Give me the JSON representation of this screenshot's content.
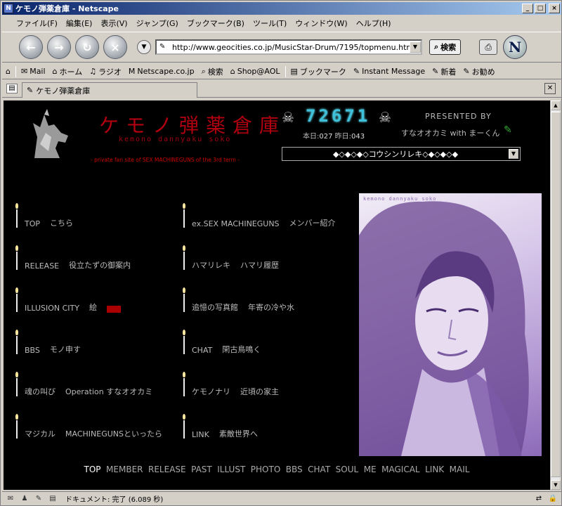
{
  "window": {
    "title": "ケモノ弾薬倉庫 - Netscape",
    "app_icon": "netscape-n-icon",
    "controls": {
      "minimize": "_",
      "maximize": "□",
      "close": "×"
    }
  },
  "menubar": {
    "items": [
      "ファイル(F)",
      "編集(E)",
      "表示(V)",
      "ジャンプ(G)",
      "ブックマーク(B)",
      "ツール(T)",
      "ウィンドウ(W)",
      "ヘルプ(H)"
    ]
  },
  "navbar": {
    "back_glyph": "←",
    "forward_glyph": "→",
    "reload_glyph": "↻",
    "stop_glyph": "×",
    "url": "http://www.geocities.co.jp/MusicStar-Drum/7195/topmenu.html",
    "search_label": "検索"
  },
  "personalbar": {
    "items": [
      {
        "label": "",
        "icon": "home-toolbar-icon",
        "glyph": "⌂"
      },
      {
        "label": "Mail",
        "icon": "mail-icon",
        "glyph": "✉"
      },
      {
        "label": "ホーム",
        "icon": "home-icon",
        "glyph": "⌂"
      },
      {
        "label": "ラジオ",
        "icon": "radio-icon",
        "glyph": "♫"
      },
      {
        "label": "Netscape.co.jp",
        "icon": "my-netscape-icon",
        "glyph": "M"
      },
      {
        "label": "検索",
        "icon": "search-icon",
        "glyph": "⌕"
      },
      {
        "label": "Shop@AOL",
        "icon": "shop-icon",
        "glyph": "⌂"
      },
      {
        "label": "ブックマーク",
        "icon": "bookmark-folder-icon",
        "glyph": "▤"
      },
      {
        "label": "Instant Message",
        "icon": "im-icon",
        "glyph": "✎"
      },
      {
        "label": "新着",
        "icon": "new-icon",
        "glyph": "✎"
      },
      {
        "label": "お勧め",
        "icon": "recommend-icon",
        "glyph": "✎"
      }
    ]
  },
  "tab": {
    "label": "ケモノ弾薬倉庫"
  },
  "page": {
    "title": "ケモノ弾薬倉庫",
    "romaji": "kemono dannyaku soko",
    "tagline": "- private fan site of SEX MACHINEGUNS of the 3rd term -",
    "counter": {
      "value": "72671",
      "today_label": "本日:",
      "today": "027",
      "yesterday_label": "昨日:",
      "yesterday": "043"
    },
    "presented": "PRESENTED BY",
    "presented_by": "すなオオカミ with まーくん",
    "select_value": "◆◇◆◇◆◇コウシンリレキ◇◆◇◆◇◆",
    "left_links": [
      {
        "label": "TOP",
        "desc": "こちら"
      },
      {
        "label": "RELEASE",
        "desc": "役立たずの御案内"
      },
      {
        "label": "ILLUSION CITY",
        "desc": "絵"
      },
      {
        "label": "BBS",
        "desc": "モノ申す"
      },
      {
        "label": "魂の叫び",
        "desc": "Operation すなオオカミ"
      },
      {
        "label": "マジカル",
        "desc": "MACHINEGUNSといったら"
      }
    ],
    "right_links": [
      {
        "label": "ex.SEX MACHINEGUNS",
        "desc": "メンバー紹介"
      },
      {
        "label": "ハマリレキ",
        "desc": "ハマリ履歴"
      },
      {
        "label": "追憶の写真館",
        "desc": "年寄の冷や水"
      },
      {
        "label": "CHAT",
        "desc": "閑古鳥鳴く"
      },
      {
        "label": "ケモノナリ",
        "desc": "近頃の家主"
      },
      {
        "label": "LINK",
        "desc": "素敵世界へ"
      }
    ],
    "photo_caption": "kemono dannyaku soko",
    "bottom_nav": [
      "TOP",
      "MEMBER",
      "RELEASE",
      "PAST",
      "ILLUST",
      "PHOTO",
      "BBS",
      "CHAT",
      "SOUL",
      "ME",
      "MAGICAL",
      "LINK",
      "MAIL"
    ]
  },
  "status": {
    "text": "ドキュメント: 完了 (6.089 秒)"
  },
  "colors": {
    "title_red": "#b00010",
    "counter_cyan": "#3fc0d8",
    "photo_violet": "#b49ad4"
  }
}
